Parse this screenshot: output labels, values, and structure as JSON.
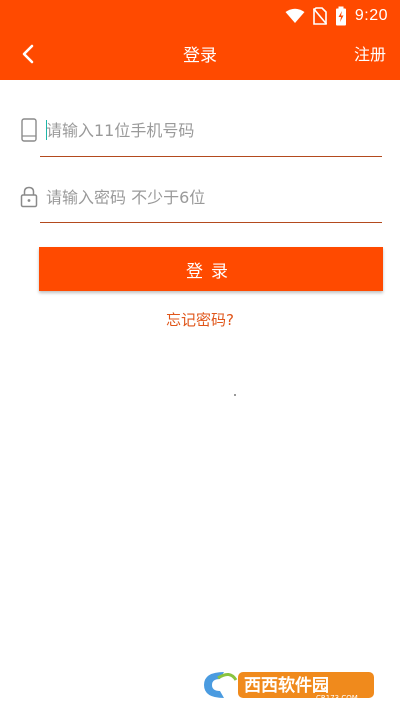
{
  "status_bar": {
    "time": "9:20",
    "icons": [
      "wifi-icon",
      "no-sim-icon",
      "battery-charging-icon"
    ]
  },
  "toolbar": {
    "title": "登录",
    "back_icon": "chevron-left-icon",
    "register_label": "注册"
  },
  "form": {
    "phone": {
      "icon": "phone-icon",
      "value": "",
      "placeholder": "请输入11位手机号码"
    },
    "password": {
      "icon": "lock-icon",
      "value": "",
      "placeholder": "请输入密码 不少于6位"
    },
    "login_label": "登录",
    "forgot_label": "忘记密码?"
  },
  "watermark": {
    "brand": "西西软件园",
    "domain": "CR173.COM"
  },
  "colors": {
    "accent": "#ff4a00",
    "link": "#e0561a",
    "underline": "#b34a1e",
    "placeholder": "#9a9a9a"
  }
}
